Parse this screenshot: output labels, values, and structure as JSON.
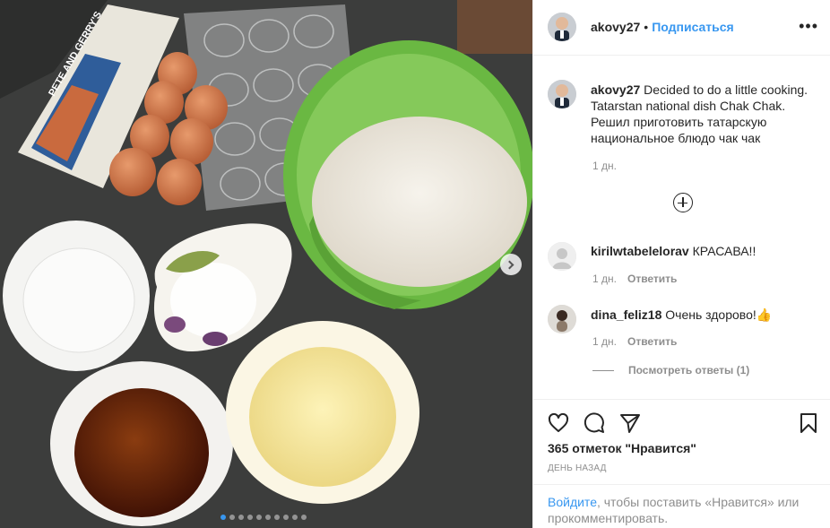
{
  "post": {
    "author": "akovy27",
    "follow_label": "Подписаться",
    "more_label": "•••",
    "caption_text": "Decided to do a little cooking. Tatarstan national dish Chak Chak. Решил приготовить татарскую национальное блюдо чак чак",
    "caption_time": "1 дн.",
    "image_count": 10,
    "image_index": 1
  },
  "comments": [
    {
      "user": "kirilwtabelelorav",
      "text": "КРАСАВА!!",
      "time": "1 дн.",
      "reply_label": "Ответить"
    },
    {
      "user": "dina_feliz18",
      "text": "Очень здорово!👍",
      "time": "1 дн.",
      "reply_label": "Ответить"
    }
  ],
  "view_replies_label": "Посмотреть ответы (1)",
  "likes_text": "365 отметок \"Нравится\"",
  "posted_ago": "ДЕНЬ НАЗАД",
  "login_prompt": {
    "link": "Войдите",
    "rest": ", чтобы поставить «Нравится» или прокомментировать."
  },
  "photo_labels": {
    "egg_carton_brand": "PETE AND GERRY'S"
  },
  "colors": {
    "link": "#3897f0",
    "text": "#262626",
    "muted": "#8e8e8e"
  }
}
